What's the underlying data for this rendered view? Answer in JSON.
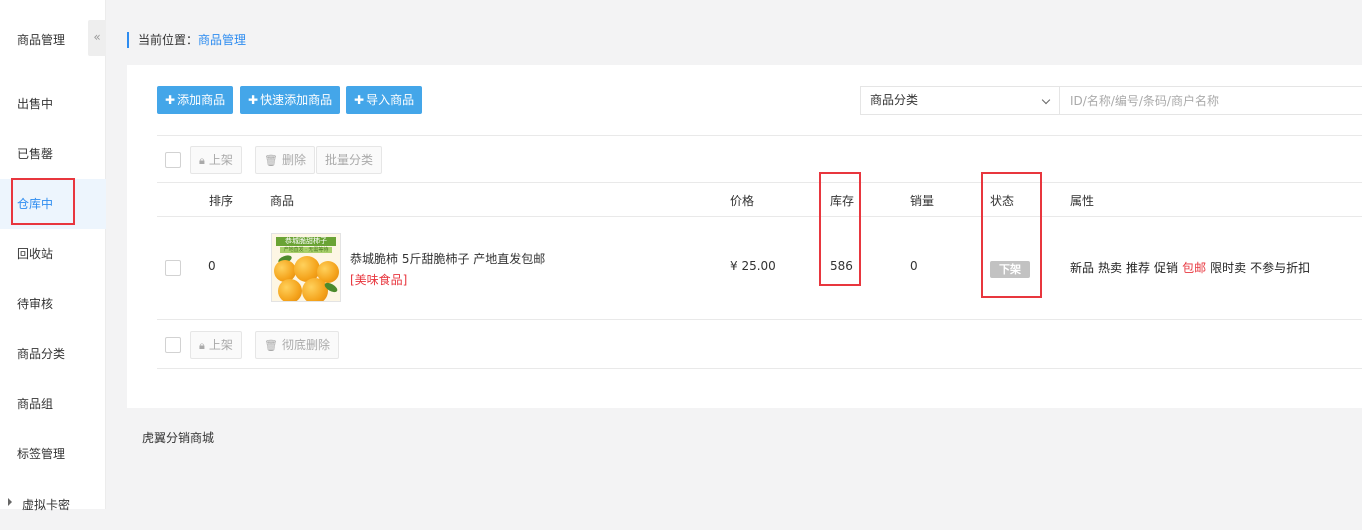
{
  "sidebar": {
    "title": "商品管理",
    "collapse_icon": "«",
    "items": [
      {
        "label": "出售中"
      },
      {
        "label": "已售罄"
      },
      {
        "label": "仓库中",
        "active": true
      },
      {
        "label": "回收站"
      },
      {
        "label": "待审核"
      },
      {
        "label": "商品分类"
      },
      {
        "label": "商品组"
      },
      {
        "label": "标签管理"
      },
      {
        "label": "虚拟卡密"
      }
    ]
  },
  "breadcrumb": {
    "prefix": "当前位置：",
    "current": "商品管理"
  },
  "toolbar": {
    "add_label": "添加商品",
    "quick_add_label": "快速添加商品",
    "import_label": "导入商品",
    "category_select": "商品分类",
    "search_placeholder": "ID/名称/编号/条码/商户名称"
  },
  "batch_top": {
    "on_shelf": "上架",
    "delete": "删除",
    "batch_category": "批量分类"
  },
  "table": {
    "headers": {
      "sort": "排序",
      "product": "商品",
      "price": "价格",
      "stock": "库存",
      "sales": "销量",
      "status": "状态",
      "attributes": "属性"
    },
    "rows": [
      {
        "sort": "0",
        "thumb_banner": "恭城脆甜柿子",
        "thumb_sub": "产地直发 · 无需等待",
        "name": "恭城脆柿 5斤甜脆柿子 产地直发包邮",
        "category": "[美味食品]",
        "price": "¥ 25.00",
        "stock": "586",
        "sales": "0",
        "status": "下架",
        "attributes": [
          "新品",
          "热卖",
          "推荐",
          "促销",
          "包邮",
          "限时卖",
          "不参与折扣"
        ],
        "highlight_attribute": "包邮"
      }
    ]
  },
  "batch_bottom": {
    "on_shelf": "上架",
    "permanent_delete": "彻底删除"
  },
  "footer": "虎翼分销商城",
  "colors": {
    "accent": "#2d8cf0",
    "button": "#44a6e9",
    "highlight_box": "#e8363e"
  }
}
